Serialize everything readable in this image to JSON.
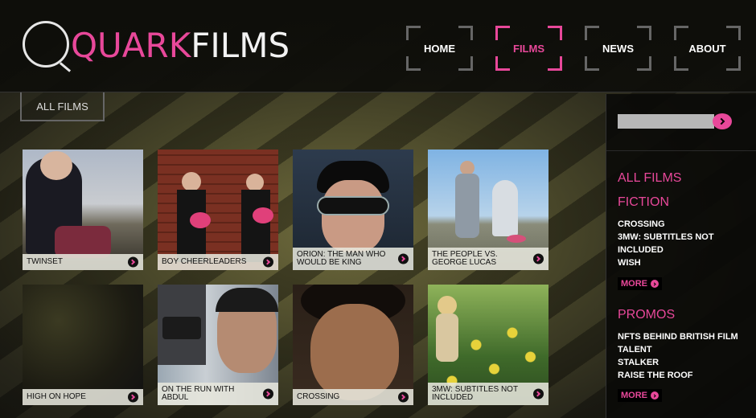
{
  "header": {
    "logo_pink": "QUARK",
    "logo_white": "FILMS"
  },
  "nav": [
    {
      "label": "HOME",
      "active": false
    },
    {
      "label": "FILMS",
      "active": true
    },
    {
      "label": "NEWS",
      "active": false
    },
    {
      "label": "ABOUT",
      "active": false
    }
  ],
  "tab": {
    "label": "ALL FILMS"
  },
  "tiles": [
    {
      "title": "TWINSET",
      "art": "twinset"
    },
    {
      "title": "BOY CHEERLEADERS",
      "art": "boy-cheerleaders"
    },
    {
      "title": "ORION: THE MAN WHO WOULD BE KING",
      "art": "orion"
    },
    {
      "title": "THE PEOPLE VS. GEORGE LUCAS",
      "art": "people-vs-lucas"
    },
    {
      "title": "HIGH ON HOPE",
      "art": "high-on-hope"
    },
    {
      "title": "ON THE RUN WITH ABDUL",
      "art": "abdul"
    },
    {
      "title": "CROSSING",
      "art": "crossing"
    },
    {
      "title": "3MW: SUBTITLES NOT INCLUDED",
      "art": "sunflowers"
    }
  ],
  "sidebar": {
    "search_placeholder": "",
    "all_films": "ALL FILMS",
    "fiction_heading": "FICTION",
    "fiction_items": [
      "CROSSING",
      "3MW: SUBTITLES NOT INCLUDED",
      "WISH"
    ],
    "more_label": "MORE",
    "promos_heading": "PROMOS",
    "promos_items": [
      "NFTS BEHIND BRITISH FILM TALENT",
      "STALKER",
      "RAISE THE ROOF"
    ]
  },
  "colors": {
    "accent": "#e8489a",
    "background": "#1a1a10"
  }
}
